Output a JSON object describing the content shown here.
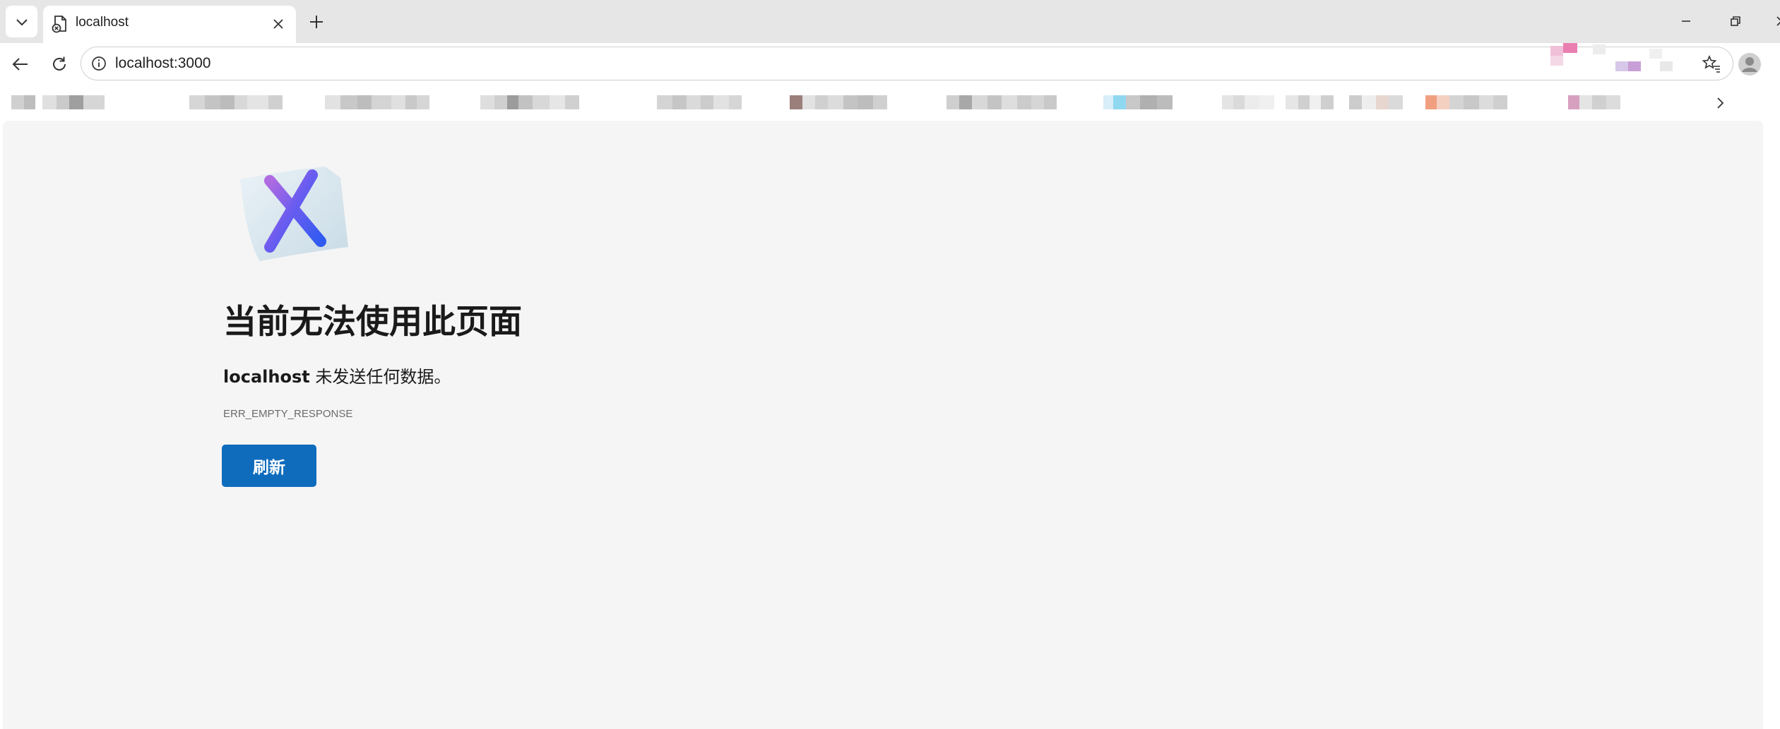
{
  "tab": {
    "title": "localhost"
  },
  "address_bar": {
    "url": "localhost:3000"
  },
  "error_page": {
    "title": "当前无法使用此页面",
    "host": "localhost",
    "message": "未发送任何数据。",
    "code": "ERR_EMPTY_RESPONSE",
    "reload_label": "刷新"
  },
  "colors": {
    "accent": "#0f6cbd",
    "content_background": "#f5f5f5",
    "tabstrip_background": "#e6e6e6"
  },
  "icons": {
    "tab_list": "chevron-down-icon",
    "favicon": "error-page-icon",
    "tab_close": "close-icon",
    "new_tab": "plus-icon",
    "back": "back-arrow-icon",
    "refresh": "refresh-icon",
    "site_info": "info-icon",
    "favorites": "favorites-star-icon",
    "profile": "profile-avatar-icon",
    "bookmarks_more": "chevron-right-icon",
    "minimize": "minimize-icon",
    "restore": "restore-icon"
  }
}
